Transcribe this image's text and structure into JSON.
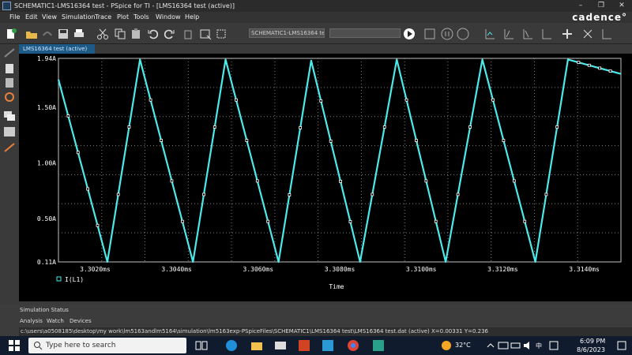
{
  "window": {
    "title": "SCHEMATIC1-LMS16364 test - PSpice for TI - [LMS16364 test (active)]",
    "controls": {
      "minimize": "–",
      "maximize": "❐",
      "close": "✕"
    }
  },
  "menu": {
    "items": [
      "File",
      "Edit",
      "View",
      "Simulation",
      "Trace",
      "Plot",
      "Tools",
      "Window",
      "Help"
    ],
    "brand": "cadence°"
  },
  "toolbar": {
    "profile_field": "SCHEMATIC1-LMS16364 test",
    "icons": [
      "new-icon",
      "open-icon",
      "undo-disabled-icon",
      "save-icon",
      "print-icon",
      "cut-icon",
      "copy-icon",
      "paste-icon",
      "undo-icon",
      "redo-icon",
      "delete-icon",
      "zoom-icon",
      "zoom-fit-icon",
      "run-icon",
      "save-data-icon",
      "pause-icon",
      "stop-icon",
      "cursor-icon",
      "marker-icon"
    ]
  },
  "plot_tab": "LMS16364 test (active)",
  "chart_data": {
    "type": "line",
    "title": "",
    "xlabel": "Time",
    "ylabel": "",
    "xlim": [
      3.3011,
      3.3149
    ],
    "ylim": [
      0.11,
      1.94
    ],
    "x_unit": "ms",
    "y_unit": "A",
    "x_ticks": [
      "3.3020ms",
      "3.3040ms",
      "3.3060ms",
      "3.3080ms",
      "3.3100ms",
      "3.3120ms",
      "3.3140ms"
    ],
    "y_ticks": [
      "0.11A",
      "0.50A",
      "1.00A",
      "1.50A",
      "1.94A"
    ],
    "grid": true,
    "legend": [
      {
        "name": "I(L1)",
        "color": "#4de8e8"
      }
    ],
    "series": [
      {
        "name": "I(L1)",
        "color": "#4de8e8",
        "x": [
          3.3011,
          3.3023,
          3.3031,
          3.3044,
          3.3052,
          3.3065,
          3.3073,
          3.3085,
          3.3094,
          3.3106,
          3.3115,
          3.3128,
          3.3136,
          3.3149
        ],
        "y": [
          1.75,
          0.11,
          1.93,
          0.11,
          1.93,
          0.11,
          1.92,
          0.11,
          1.93,
          0.11,
          1.93,
          0.11,
          1.93,
          1.8
        ]
      }
    ]
  },
  "status": {
    "title": "Simulation Status",
    "tabs": [
      "Analysis",
      "Watch",
      "Devices"
    ],
    "path": "c:\\users\\a0508185\\desktop\\my work\\lm5163andlm5164\\simulation\\lm5163exp-PSpiceFiles\\SCHEMATIC1\\LMS16364 test\\LMS16364 test.dat (active)   X=0.00331  Y=0.236"
  },
  "taskbar": {
    "search_placeholder": "Type here to search",
    "weather": "32°C",
    "time": "6:09 PM",
    "date": "8/6/2023",
    "lang": "中"
  },
  "colors": {
    "trace": "#4de8e8",
    "grid": "#808080",
    "background": "#000000",
    "axis_text": "#ffffff"
  }
}
